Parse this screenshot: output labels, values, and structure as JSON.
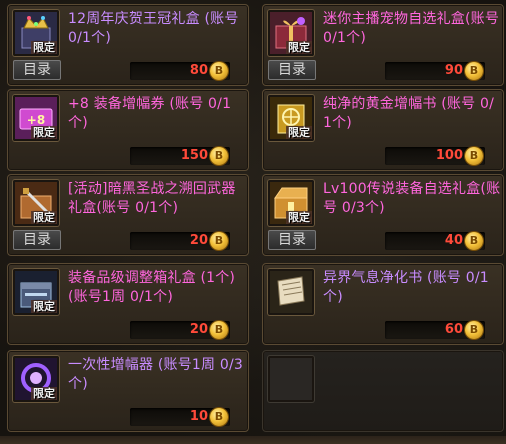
{
  "shop": {
    "limited_label": "限定",
    "catalog_label": "目录",
    "coin_symbol": "B",
    "items": [
      {
        "name": "12周年庆贺王冠礼盒 (账号 0/1个)",
        "price": "80"
      },
      {
        "name": "迷你主播宠物自选礼盒(账号 0/1个)",
        "price": "90"
      },
      {
        "name": "+8 装备增幅券 (账号 0/1个)",
        "price": "150"
      },
      {
        "name": "纯净的黄金增幅书 (账号 0/1个)",
        "price": "100"
      },
      {
        "name": "[活动]暗黑圣战之溯回武器礼盒(账号 0/1个)",
        "price": "20"
      },
      {
        "name": "Lv100传说装备自选礼盒(账号 0/3个)",
        "price": "40"
      },
      {
        "name": "装备品级调整箱礼盒 (1个)(账号1周 0/1个)",
        "price": "20"
      },
      {
        "name": "异界气息净化书 (账号 0/1个)",
        "price": "60"
      },
      {
        "name": "一次性增幅器 (账号1周 0/3个)",
        "price": "10"
      }
    ]
  },
  "colors": {
    "price": "#ff4a3a",
    "name_purple": "#c88cff",
    "name_pink": "#ff66dd",
    "card_border": "#5a4a33"
  }
}
